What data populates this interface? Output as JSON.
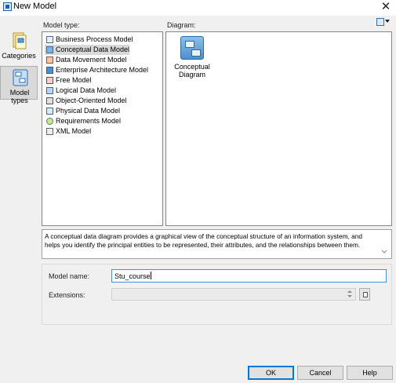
{
  "window": {
    "title": "New Model"
  },
  "categories": [
    {
      "label": "Categories",
      "selected": false,
      "icon": "categories-icon"
    },
    {
      "label": "Model types",
      "selected": true,
      "icon": "model-types-icon"
    }
  ],
  "model_type_panel": {
    "label": "Model type:",
    "items": [
      {
        "label": "Business Process Model",
        "icon": "business-process-model-icon",
        "selected": false
      },
      {
        "label": "Conceptual Data Model",
        "icon": "conceptual-data-model-icon",
        "selected": true
      },
      {
        "label": "Data Movement Model",
        "icon": "data-movement-model-icon",
        "selected": false
      },
      {
        "label": "Enterprise Architecture Model",
        "icon": "enterprise-architecture-model-icon",
        "selected": false
      },
      {
        "label": "Free Model",
        "icon": "free-model-icon",
        "selected": false
      },
      {
        "label": "Logical Data Model",
        "icon": "logical-data-model-icon",
        "selected": false
      },
      {
        "label": "Object-Oriented Model",
        "icon": "object-oriented-model-icon",
        "selected": false
      },
      {
        "label": "Physical Data Model",
        "icon": "physical-data-model-icon",
        "selected": false
      },
      {
        "label": "Requirements Model",
        "icon": "requirements-model-icon",
        "selected": false
      },
      {
        "label": "XML Model",
        "icon": "xml-model-icon",
        "selected": false
      }
    ]
  },
  "diagram_panel": {
    "label": "Diagram:",
    "items": [
      {
        "label_line1": "Conceptual",
        "label_line2": "Diagram",
        "icon": "conceptual-diagram-icon"
      }
    ]
  },
  "description": "A conceptual data diagram provides a graphical view of the conceptual structure of an information system, and helps you identify the principal entities to be represented, their attributes, and the relationships between them.",
  "model_name": {
    "label": "Model name:",
    "value": "Stu_course"
  },
  "extensions": {
    "label": "Extensions:",
    "value": ""
  },
  "buttons": {
    "ok": "OK",
    "cancel": "Cancel",
    "help": "Help"
  },
  "colors": {
    "selection": "#d9d9d9",
    "focus_border": "#4a8fd9",
    "default_button_border": "#0078d7"
  }
}
